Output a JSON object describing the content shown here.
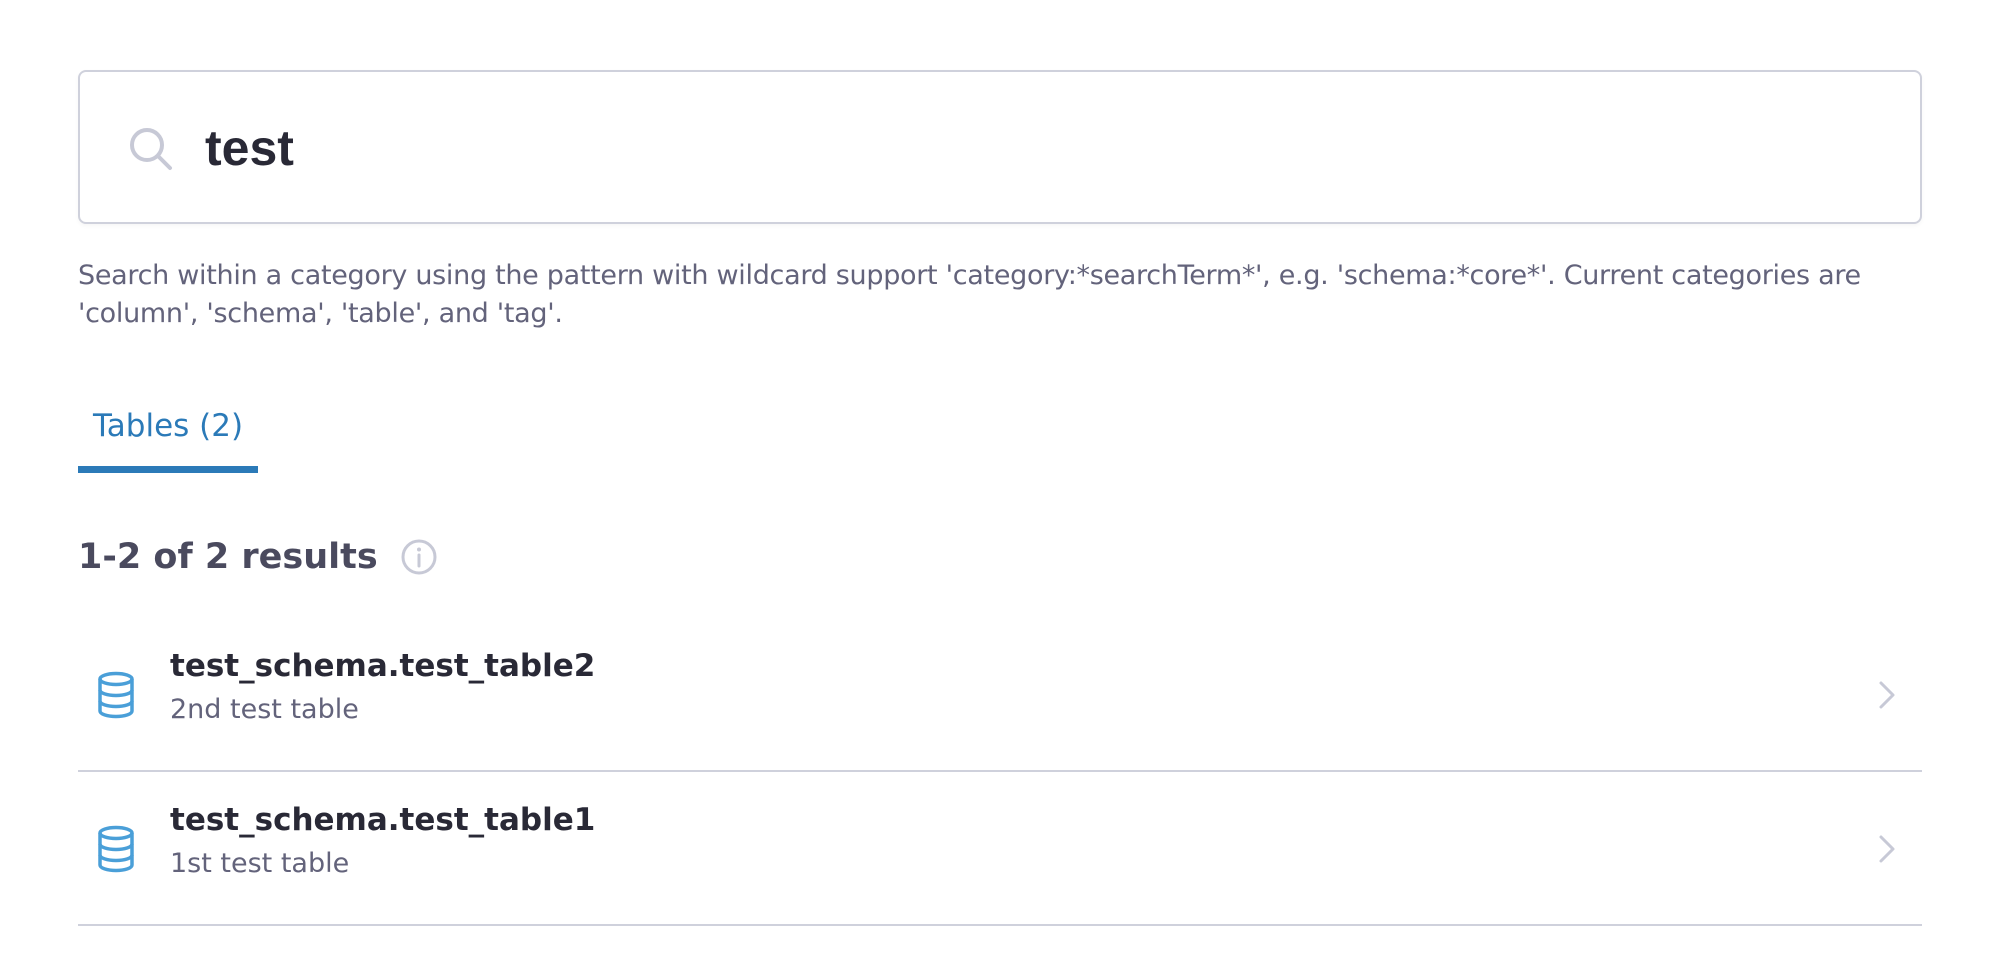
{
  "search": {
    "value": "test",
    "helper_text": "Search within a category using the pattern with wildcard support 'category:*searchTerm*', e.g. 'schema:*core*'. Current categories are 'column', 'schema', 'table', and 'tag'."
  },
  "tabs": [
    {
      "label": "Tables (2)",
      "active": true
    }
  ],
  "results": {
    "count_label": "1-2 of 2 results",
    "items": [
      {
        "title": "test_schema.test_table2",
        "subtitle": "2nd test table",
        "icon": "database-icon"
      },
      {
        "title": "test_schema.test_table1",
        "subtitle": "1st test table",
        "icon": "database-icon"
      }
    ]
  },
  "colors": {
    "accent": "#2b7ab8",
    "db_icon": "#4a9fd8",
    "text_primary": "#292936",
    "text_secondary": "#63637b",
    "border": "#cfd1dc",
    "icon_muted": "#c7c9d6"
  }
}
